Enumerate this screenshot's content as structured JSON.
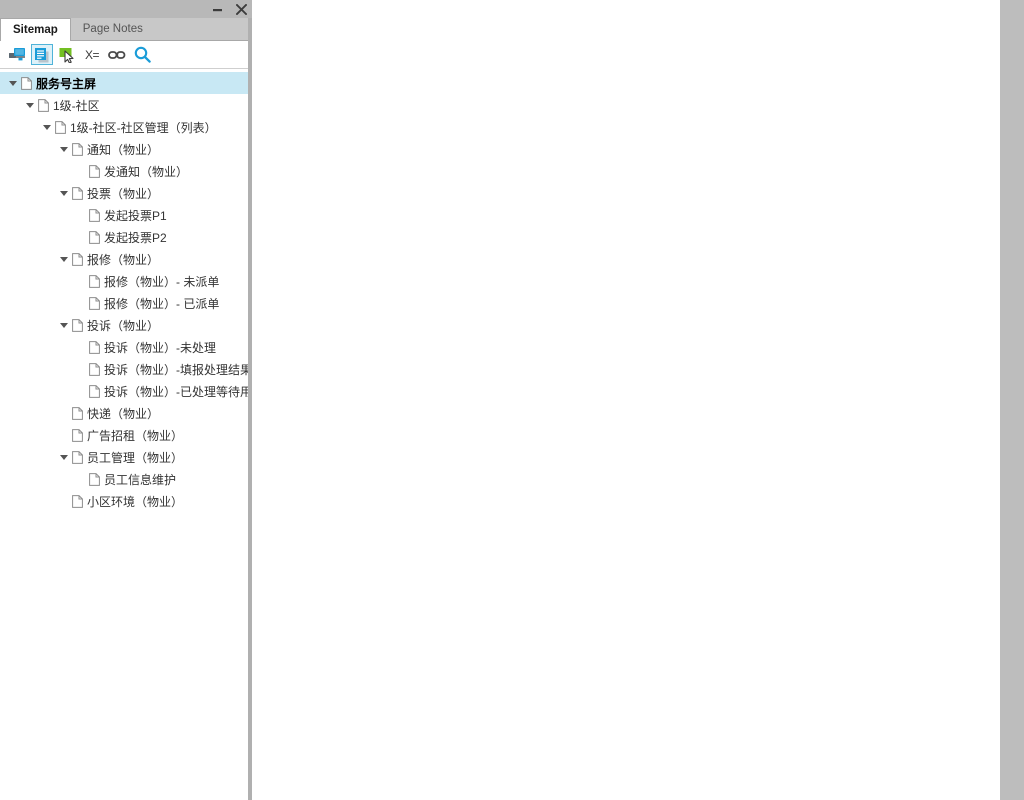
{
  "window": {
    "controls": [
      {
        "name": "minimize-button",
        "glyph": "minimize-icon"
      },
      {
        "name": "close-button",
        "glyph": "close-icon"
      }
    ]
  },
  "tabs": [
    {
      "label": "Sitemap",
      "active": true
    },
    {
      "label": "Page Notes",
      "active": false
    }
  ],
  "toolbar": {
    "items": [
      {
        "name": "add-page-icon",
        "kind": "icon-monitor",
        "selected": false
      },
      {
        "name": "duplicate-page-icon",
        "kind": "icon-pages",
        "selected": true
      },
      {
        "name": "move-page-icon",
        "kind": "icon-cursor-green",
        "selected": false
      },
      {
        "name": "delete-page-icon",
        "kind": "icon-x-equals",
        "selected": false,
        "text": "X="
      },
      {
        "name": "link-icon",
        "kind": "icon-link",
        "selected": false
      },
      {
        "name": "search-icon",
        "kind": "icon-search",
        "selected": false
      }
    ]
  },
  "tree": {
    "nodes": [
      {
        "label": "服务号主屏",
        "depth": 0,
        "expanded": true,
        "hasChildren": true,
        "selected": true
      },
      {
        "label": "1级-社区",
        "depth": 1,
        "expanded": true,
        "hasChildren": true,
        "selected": false
      },
      {
        "label": "1级-社区-社区管理（列表）",
        "depth": 2,
        "expanded": true,
        "hasChildren": true,
        "selected": false
      },
      {
        "label": "通知（物业）",
        "depth": 3,
        "expanded": true,
        "hasChildren": true,
        "selected": false
      },
      {
        "label": "发通知（物业）",
        "depth": 4,
        "expanded": false,
        "hasChildren": false,
        "selected": false
      },
      {
        "label": "投票（物业）",
        "depth": 3,
        "expanded": true,
        "hasChildren": true,
        "selected": false
      },
      {
        "label": "发起投票P1",
        "depth": 4,
        "expanded": false,
        "hasChildren": false,
        "selected": false
      },
      {
        "label": "发起投票P2",
        "depth": 4,
        "expanded": false,
        "hasChildren": false,
        "selected": false
      },
      {
        "label": "报修（物业）",
        "depth": 3,
        "expanded": true,
        "hasChildren": true,
        "selected": false
      },
      {
        "label": "报修（物业）- 未派单",
        "depth": 4,
        "expanded": false,
        "hasChildren": false,
        "selected": false
      },
      {
        "label": "报修（物业）- 已派单",
        "depth": 4,
        "expanded": false,
        "hasChildren": false,
        "selected": false
      },
      {
        "label": "投诉（物业）",
        "depth": 3,
        "expanded": true,
        "hasChildren": true,
        "selected": false
      },
      {
        "label": "投诉（物业）-未处理",
        "depth": 4,
        "expanded": false,
        "hasChildren": false,
        "selected": false
      },
      {
        "label": "投诉（物业）-填报处理结果",
        "depth": 4,
        "expanded": false,
        "hasChildren": false,
        "selected": false
      },
      {
        "label": "投诉（物业）-已处理等待用",
        "depth": 4,
        "expanded": false,
        "hasChildren": false,
        "selected": false
      },
      {
        "label": "快递（物业）",
        "depth": 3,
        "expanded": false,
        "hasChildren": false,
        "selected": false
      },
      {
        "label": "广告招租（物业）",
        "depth": 3,
        "expanded": false,
        "hasChildren": false,
        "selected": false
      },
      {
        "label": "员工管理（物业）",
        "depth": 3,
        "expanded": true,
        "hasChildren": true,
        "selected": false
      },
      {
        "label": "员工信息维护",
        "depth": 4,
        "expanded": false,
        "hasChildren": false,
        "selected": false
      },
      {
        "label": "小区环境（物业）",
        "depth": 3,
        "expanded": false,
        "hasChildren": false,
        "selected": false
      }
    ]
  },
  "colors": {
    "selection": "#c8e8f4",
    "titlebar": "#b8b8b8",
    "tabstrip": "#c8c8c8",
    "accent": "#29a3d6",
    "right_strip": "#bdbdbd"
  }
}
